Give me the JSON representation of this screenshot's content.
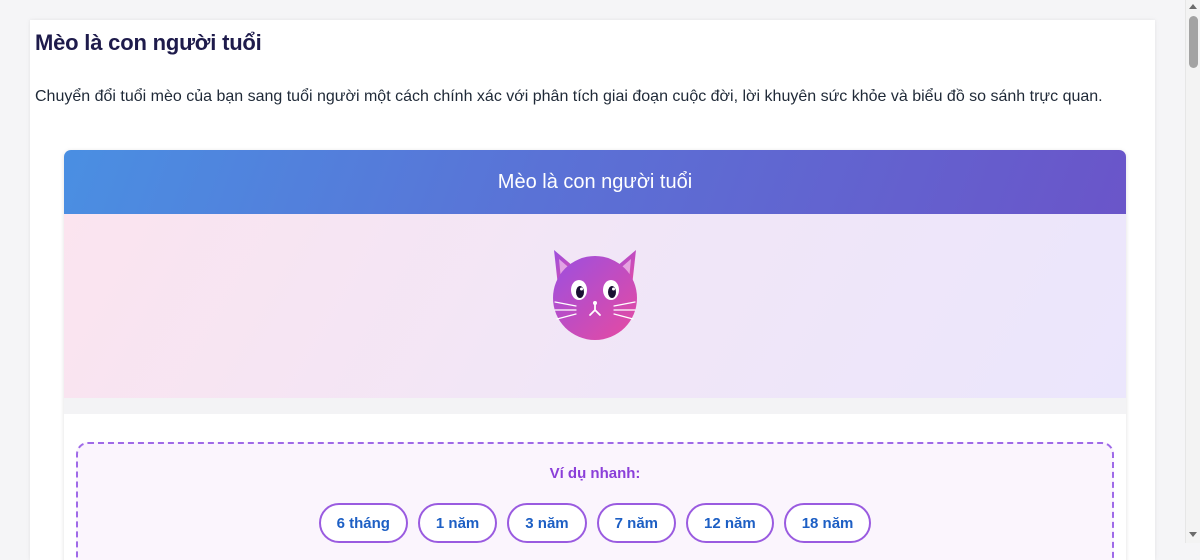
{
  "page": {
    "title": "Mèo là con người tuổi",
    "description": "Chuyển đổi tuổi mèo của bạn sang tuổi người một cách chính xác với phân tích giai đoạn cuộc đời, lời khuyên sức khỏe và biểu đồ so sánh trực quan."
  },
  "widget": {
    "header_title": "Mèo là con người tuổi",
    "hero_icon": "cat-face-icon",
    "examples": {
      "title": "Ví dụ nhanh:",
      "chips": [
        "6 tháng",
        "1 năm",
        "3 năm",
        "7 năm",
        "12 năm",
        "18 năm"
      ]
    }
  },
  "colors": {
    "header_gradient_start": "#4a8fe2",
    "header_gradient_end": "#6a55c9",
    "accent_purple": "#9a5be0",
    "chip_text": "#1d5fc4",
    "cat_gradient_start": "#9b4fe0",
    "cat_gradient_end": "#e84aa0"
  }
}
